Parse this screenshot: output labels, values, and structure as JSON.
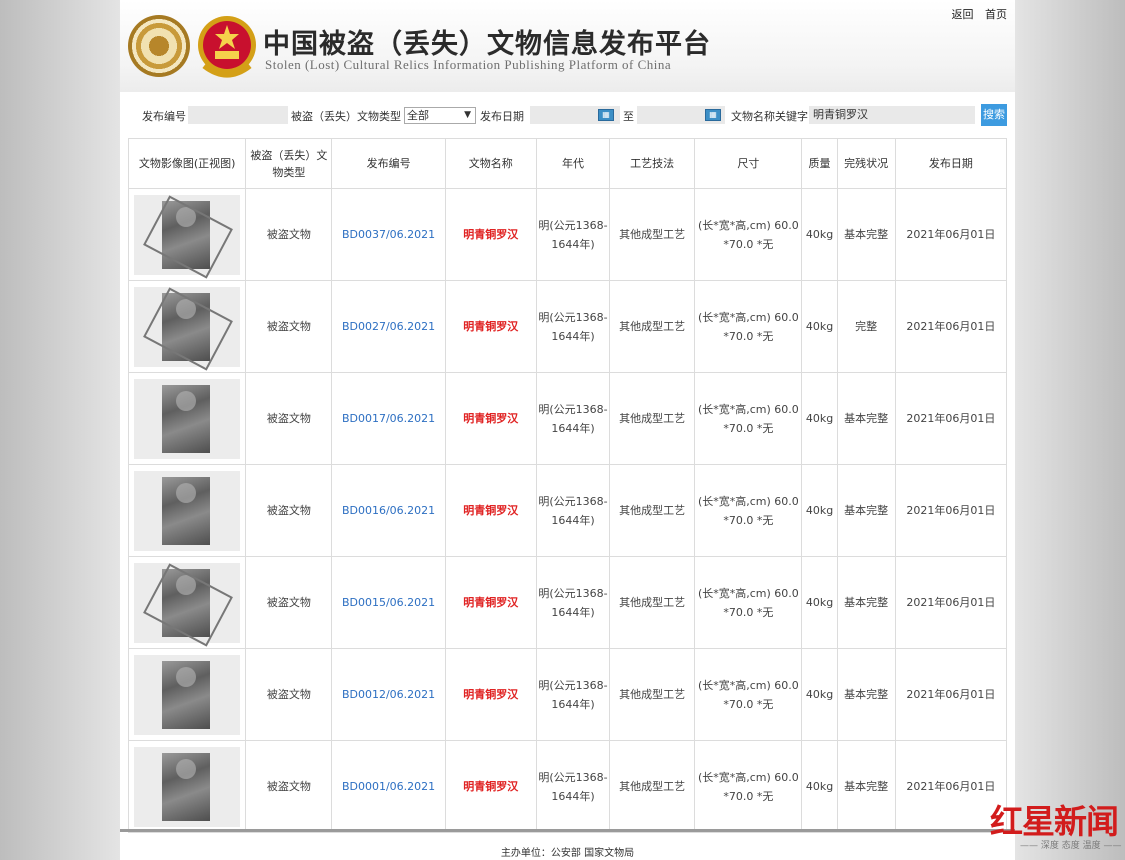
{
  "header": {
    "title_cn": "中国被盗（丢失）文物信息发布平台",
    "title_en": "Stolen (Lost) Cultural Relics Information Publishing Platform of China",
    "links": [
      "返回",
      "首页"
    ]
  },
  "search": {
    "code_label": "发布编号",
    "code_value": "",
    "type_label": "被盗（丢失）文物类型",
    "type_selected": "全部",
    "date_label": "发布日期",
    "date_from": "",
    "date_sep": "至",
    "date_to": "",
    "keyword_label": "文物名称关键字",
    "keyword_value": "明青铜罗汉",
    "search_button": "搜索"
  },
  "table": {
    "headers": [
      "文物影像图(正视图)",
      "被盗（丢失）文物类型",
      "发布编号",
      "文物名称",
      "年代",
      "工艺技法",
      "尺寸",
      "质量",
      "完残状况",
      "发布日期"
    ],
    "rows": [
      {
        "type": "被盗文物",
        "code": "BD0037/06.2021",
        "name": "明青铜罗汉",
        "era": "明(公元1368-1644年)",
        "craft": "其他成型工艺",
        "size": "(长*宽*高,cm) 60.0 *70.0 *无",
        "weight": "40kg",
        "condition": "基本完整",
        "date": "2021年06月01日"
      },
      {
        "type": "被盗文物",
        "code": "BD0027/06.2021",
        "name": "明青铜罗汉",
        "era": "明(公元1368-1644年)",
        "craft": "其他成型工艺",
        "size": "(长*宽*高,cm) 60.0 *70.0 *无",
        "weight": "40kg",
        "condition": "完整",
        "date": "2021年06月01日"
      },
      {
        "type": "被盗文物",
        "code": "BD0017/06.2021",
        "name": "明青铜罗汉",
        "era": "明(公元1368-1644年)",
        "craft": "其他成型工艺",
        "size": "(长*宽*高,cm) 60.0 *70.0 *无",
        "weight": "40kg",
        "condition": "基本完整",
        "date": "2021年06月01日"
      },
      {
        "type": "被盗文物",
        "code": "BD0016/06.2021",
        "name": "明青铜罗汉",
        "era": "明(公元1368-1644年)",
        "craft": "其他成型工艺",
        "size": "(长*宽*高,cm) 60.0 *70.0 *无",
        "weight": "40kg",
        "condition": "基本完整",
        "date": "2021年06月01日"
      },
      {
        "type": "被盗文物",
        "code": "BD0015/06.2021",
        "name": "明青铜罗汉",
        "era": "明(公元1368-1644年)",
        "craft": "其他成型工艺",
        "size": "(长*宽*高,cm) 60.0 *70.0 *无",
        "weight": "40kg",
        "condition": "基本完整",
        "date": "2021年06月01日"
      },
      {
        "type": "被盗文物",
        "code": "BD0012/06.2021",
        "name": "明青铜罗汉",
        "era": "明(公元1368-1644年)",
        "craft": "其他成型工艺",
        "size": "(长*宽*高,cm) 60.0 *70.0 *无",
        "weight": "40kg",
        "condition": "基本完整",
        "date": "2021年06月01日"
      },
      {
        "type": "被盗文物",
        "code": "BD0001/06.2021",
        "name": "明青铜罗汉",
        "era": "明(公元1368-1644年)",
        "craft": "其他成型工艺",
        "size": "(长*宽*高,cm) 60.0 *70.0 *无",
        "weight": "40kg",
        "condition": "基本完整",
        "date": "2021年06月01日"
      }
    ]
  },
  "footer": {
    "sponsor": "主办单位：公安部  国家文物局"
  },
  "watermark": {
    "main": "红星新闻",
    "sub": "—— 深度 态度 温度 ——"
  },
  "colors": {
    "link_blue": "#2d6fc2",
    "relic_red": "#e02222",
    "search_button": "#3d9be0",
    "calendar_icon": "#3c8fc6"
  },
  "icons": [
    "police-emblem-icon",
    "national-emblem-icon",
    "calendar-icon",
    "dropdown-arrow-icon"
  ]
}
